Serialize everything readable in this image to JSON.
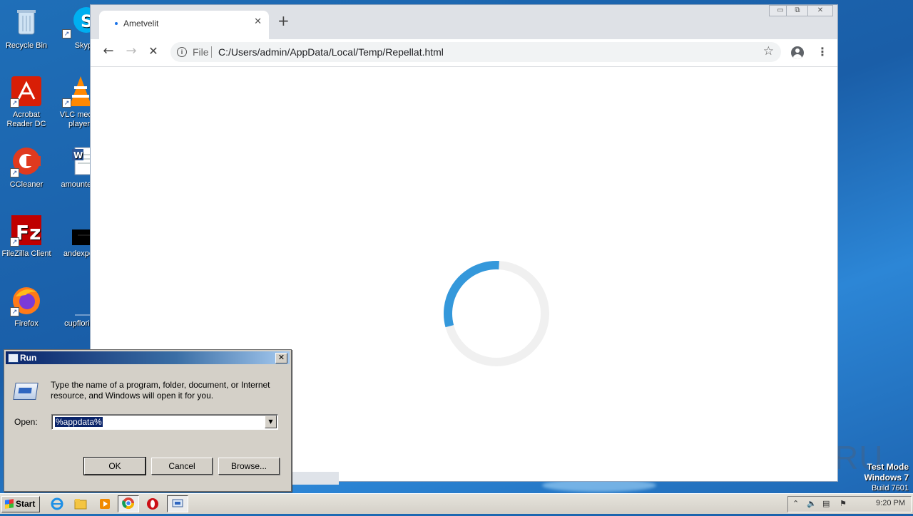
{
  "desktop": {
    "icons": [
      {
        "label": "Recycle Bin"
      },
      {
        "label": "Skype"
      },
      {
        "label": "Acrobat Reader DC"
      },
      {
        "label": "VLC media player"
      },
      {
        "label": "CCleaner"
      },
      {
        "label": "amountene"
      },
      {
        "label": "FileZilla Client"
      },
      {
        "label": "andexperi"
      },
      {
        "label": "Firefox"
      },
      {
        "label": "cupflorida"
      }
    ],
    "test_mode": {
      "line1": "Test Mode",
      "line2": "Windows 7",
      "line3": "Build 7601"
    },
    "watermark": "ANY RUN"
  },
  "browser": {
    "tab_title": "Ametvelit",
    "tab_close": "✕",
    "new_tab": "+",
    "window_controls": {
      "minimize": "▭",
      "restore": "⧉",
      "close": "✕"
    },
    "nav": {
      "back": "←",
      "forward": "→",
      "stop": "✕"
    },
    "omnibox": {
      "scheme_label": "File",
      "url": "C:/Users/admin/AppData/Local/Temp/Repellat.html",
      "star": "☆"
    },
    "menu": "⋮",
    "loading_spinner": {
      "progress": 0.3
    }
  },
  "run_dialog": {
    "title": "Run",
    "close": "✕",
    "description": "Type the name of a program, folder, document, or Internet resource, and Windows will open it for you.",
    "open_label": "Open:",
    "open_value": "%appdata%",
    "dropdown": "▼",
    "ok": "OK",
    "cancel": "Cancel",
    "browse": "Browse..."
  },
  "taskbar": {
    "start": "Start",
    "clock": "9:20 PM",
    "items": [
      "ie-icon",
      "explorer-icon",
      "media-player-icon",
      "chrome-icon",
      "opera-icon",
      "run-icon"
    ]
  }
}
